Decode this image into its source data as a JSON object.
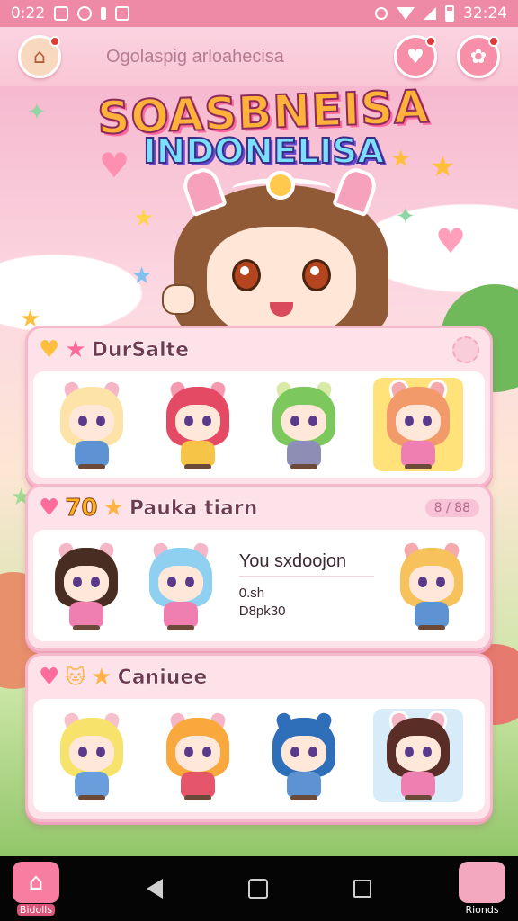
{
  "status_bar": {
    "time_left": "0:22",
    "time_right": "32:24"
  },
  "header": {
    "title": "Ogolaspig arloahecisa",
    "home_icon": "house-icon",
    "actions": [
      "heart-icon",
      "gift-icon"
    ]
  },
  "logo": {
    "line1": "SOASBNEISA",
    "line2": "INDONELISA"
  },
  "panels": [
    {
      "title": "DurSalte",
      "characters": [
        {
          "hair": "#fde3a8",
          "ear": "#f5b7c7",
          "outfit": "#5e93d3"
        },
        {
          "hair": "#e44a63",
          "ear": "#f59ab1",
          "outfit": "#f6c446"
        },
        {
          "hair": "#7cc85c",
          "ear": "#d8e9a8",
          "outfit": "#8e8db5"
        },
        {
          "hair": "#f39a6b",
          "ear": "#f6a9ad",
          "outfit": "#f07fb1",
          "framed": true
        }
      ]
    },
    {
      "number": "70",
      "title": "Pauka tiarn",
      "badge": "8 / 88",
      "info": {
        "title": "You sxdoojon",
        "line1": "0.sh",
        "line2": "D8pk30"
      },
      "characters": [
        {
          "hair": "#4a2d22",
          "ear": "#f5b7c7",
          "outfit": "#f07fb1"
        },
        {
          "hair": "#8fd0f0",
          "ear": "#f5b7c7",
          "outfit": "#f07fb1"
        },
        {
          "hair": "#f7c25c",
          "ear": "#f6a9ad",
          "outfit": "#5e93d3"
        }
      ]
    },
    {
      "title": "Caniuee",
      "characters": [
        {
          "hair": "#f7e36b",
          "ear": "#f6c0cc",
          "outfit": "#6a9ddc"
        },
        {
          "hair": "#f8a83c",
          "ear": "#f5b7c7",
          "outfit": "#e6566b"
        },
        {
          "hair": "#2f6eb8",
          "ear": "#2f6eb8",
          "outfit": "#5e93d3"
        },
        {
          "hair": "#5a2d26",
          "ear": "#f5b7c7",
          "outfit": "#f07fb1",
          "framed": true,
          "frame": "blue"
        }
      ]
    }
  ],
  "nav": {
    "home_label": "Bidolls",
    "profile_label": "Rionds"
  },
  "colors": {
    "accent": "#f78fa9",
    "panel_bg": "#fde2ea",
    "status_bar": "#ee8aa6"
  }
}
